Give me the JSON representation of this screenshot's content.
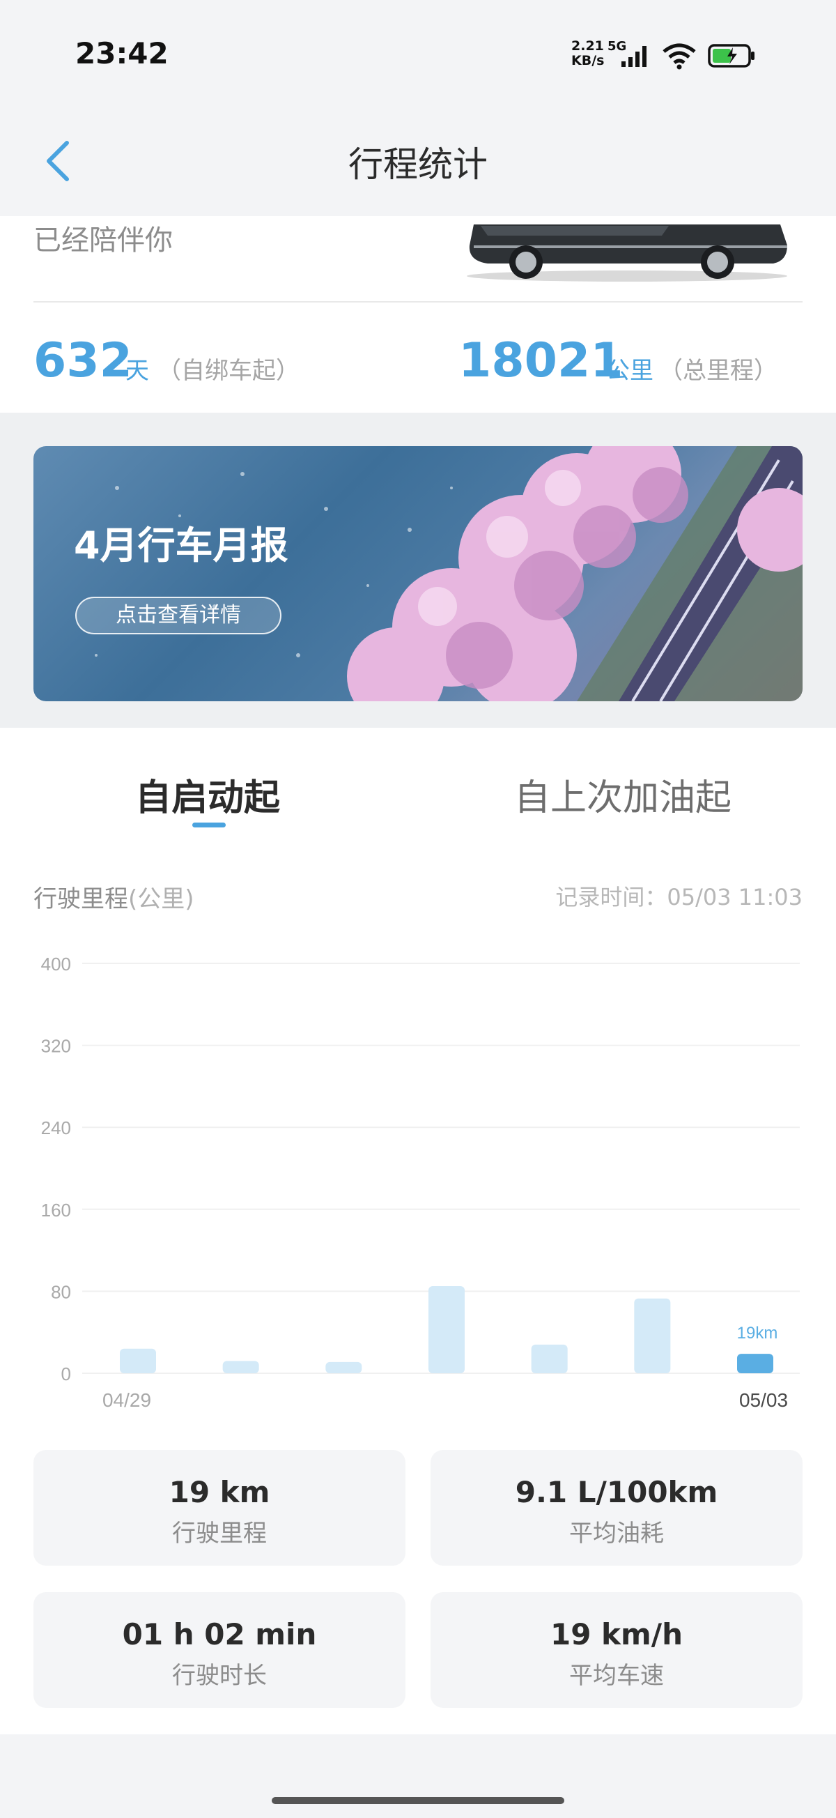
{
  "status_bar": {
    "time": "23:42",
    "net_speed_value": "2.21",
    "net_speed_unit": "KB/s",
    "network_type": "5G"
  },
  "nav": {
    "title": "行程统计"
  },
  "summary": {
    "companion_label": "已经陪伴你",
    "days_value": "632",
    "days_unit": "天",
    "days_note": "（自绑车起）",
    "mileage_value": "18021",
    "mileage_unit": "公里",
    "mileage_note": "（总里程）"
  },
  "banner": {
    "title": "4月行车月报",
    "button_label": "点击查看详情"
  },
  "tabs": [
    {
      "label": "自启动起",
      "active": true
    },
    {
      "label": "自上次加油起",
      "active": false
    }
  ],
  "chart_header": {
    "label": "行驶里程",
    "unit": "(公里)",
    "record_time": "记录时间：05/03 11:03"
  },
  "chart_data": {
    "type": "bar",
    "title": "",
    "ylabel": "行驶里程(公里)",
    "ylim": [
      0,
      400
    ],
    "yticks": [
      0,
      80,
      160,
      240,
      320,
      400
    ],
    "x_tick_labels": [
      "04/29",
      "05/03"
    ],
    "values": [
      24,
      12,
      11,
      85,
      28,
      73,
      19
    ],
    "highlight_index": 6,
    "data_label": "19km",
    "colors": {
      "bar": "#d4eaf8",
      "highlight": "#5aaee3",
      "grid": "#f0f0f0",
      "tick": "#a9a9a9"
    }
  },
  "stats": {
    "distance": {
      "value": "19 km",
      "label": "行驶里程"
    },
    "fuel": {
      "value": "9.1 L/100km",
      "label": "平均油耗"
    },
    "duration": {
      "value": "01 h 02 min",
      "label": "行驶时长"
    },
    "speed": {
      "value": "19 km/h",
      "label": "平均车速"
    }
  },
  "colors": {
    "accent": "#4aa3df",
    "page_bg": "#f3f4f6"
  }
}
